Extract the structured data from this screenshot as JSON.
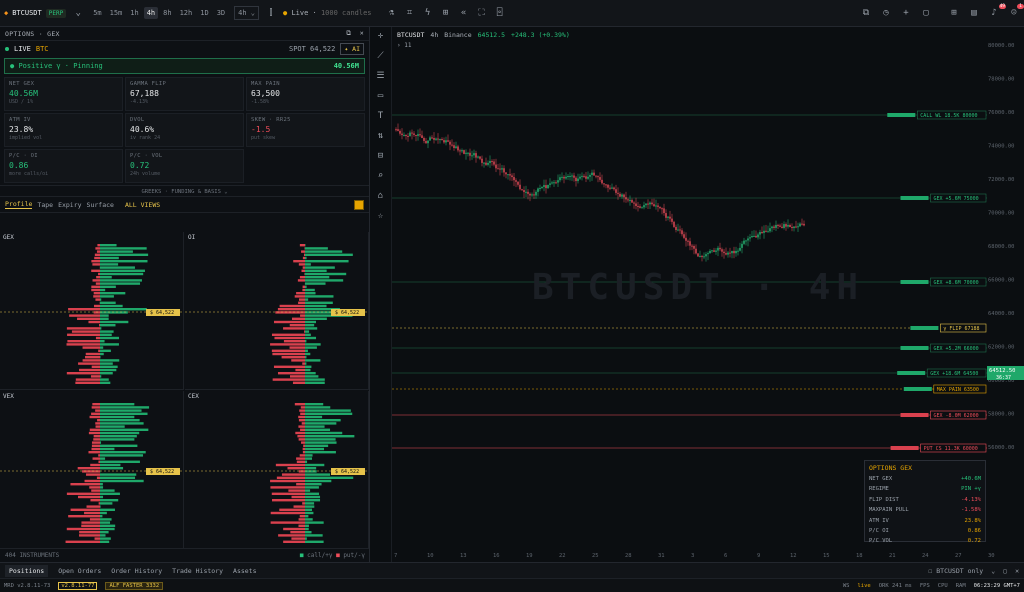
{
  "topbar": {
    "symbol": "BTCUSDT",
    "badge": "PERP",
    "timeframes": [
      "5m",
      "15m",
      "1h",
      "4h",
      "8h",
      "12h",
      "1D",
      "3D"
    ],
    "active_tf": "4h",
    "tf_select": "4h",
    "live_label": "Live",
    "candles_label": "1000 candles",
    "notif_count_1": "49",
    "notif_count_2": "1"
  },
  "left": {
    "header": "OPTIONS · GEX",
    "live": "LIVE",
    "asset": "BTC",
    "spot": "SPOT 64,522",
    "ai": "AI",
    "regime_label": "Positive γ · Pinning",
    "regime_value": "40.56M",
    "cards": [
      {
        "t": "NET GEX",
        "v": "40.56M",
        "s": "USD / 1%",
        "cls": "green"
      },
      {
        "t": "GAMMA FLIP",
        "v": "67,188",
        "s": "-4.13%",
        "cls": ""
      },
      {
        "t": "MAX PAIN",
        "v": "63,500",
        "s": "-1.58%",
        "cls": ""
      },
      {
        "t": "ATM IV",
        "v": "23.8%",
        "s": "implied vol",
        "cls": ""
      },
      {
        "t": "DVOL",
        "v": "40.6%",
        "s": "iv rank 24",
        "cls": ""
      },
      {
        "t": "SKEW · RR25",
        "v": "-1.5",
        "s": "put skew",
        "cls": "red"
      },
      {
        "t": "P/C · OI",
        "v": "0.86",
        "s": "more calls/oi",
        "cls": "green"
      },
      {
        "t": "P/C · VOL",
        "v": "0.72",
        "s": "24h volume",
        "cls": "green"
      }
    ],
    "greeks": "GREEKS · FUNDING & BASIS ⌄",
    "tabs": [
      "Profile",
      "Tape",
      "Expiry",
      "Surface"
    ],
    "allviews": "ALL VIEWS",
    "panels": [
      {
        "name": "GEX",
        "spot": "$ 64,522"
      },
      {
        "name": "OI",
        "spot": "$ 64,522"
      },
      {
        "name": "VEX",
        "spot": "$ 64,522"
      },
      {
        "name": "CEX",
        "spot": "$ 64,522"
      }
    ],
    "foot_left": "404 INSTRUMENTS",
    "foot_right_1": "call/+γ",
    "foot_right_2": "put/-γ"
  },
  "chart": {
    "symbol": "BTCUSDT",
    "tf": "4h",
    "exch": "Binance",
    "price": "64512.5",
    "change": "+248.3 (+0.39%)",
    "sub": "› 11",
    "watermark": "BTCUSDT · 4H",
    "yticks": [
      "80000.00",
      "78000.00",
      "76000.00",
      "74000.00",
      "72000.00",
      "70000.00",
      "68000.00",
      "66000.00",
      "64000.00",
      "62000.00",
      "60000.00",
      "58000.00",
      "56000.00"
    ],
    "xticks": [
      "7",
      "10",
      "13",
      "16",
      "19",
      "22",
      "25",
      "28",
      "31",
      "3",
      "6",
      "9",
      "12",
      "15",
      "18",
      "21",
      "24",
      "27",
      "30"
    ],
    "levels": [
      {
        "label": "CALL WL 18.5K 80000",
        "color": "#1f6f4a"
      },
      {
        "label": "GEX +5.6M 75000",
        "color": "#1f6f4a"
      },
      {
        "label": "GEX +8.6M 70000",
        "color": "#1f6f4a"
      },
      {
        "label": "γ FLIP 67188",
        "color": "#e6c34a"
      },
      {
        "label": "GEX +5.2M 66000",
        "color": "#1f6f4a"
      },
      {
        "label": "GEX +18.6M 64500",
        "color": "#1f6f4a"
      },
      {
        "label": "MAX PAIN 63500",
        "color": "#e6a400"
      },
      {
        "label": "GEX -8.0M 62000",
        "color": "#ef4d5a"
      },
      {
        "label": "PUT CS 11.3K 60000",
        "color": "#ef4d5a"
      }
    ],
    "last_price": "64512.50",
    "countdown": "36:37",
    "ogex": {
      "title": "OPTIONS GEX",
      "rows": [
        [
          "NET GEX",
          "+40.6M"
        ],
        [
          "REGIME",
          "PIN +γ"
        ],
        [
          "FLIP DIST",
          "-4.13%"
        ],
        [
          "MAXPAIN PULL",
          "-1.58%"
        ],
        [
          "ATM IV",
          "23.8%"
        ],
        [
          "P/C OI",
          "0.86"
        ],
        [
          "P/C VOL",
          "0.72"
        ]
      ]
    }
  },
  "bottom": {
    "tabs": [
      "Positions",
      "Open Orders",
      "Order History",
      "Trade History",
      "Assets"
    ],
    "filter": "BTCUSDT only"
  },
  "status": {
    "mrd": "MRD v2.8.11-73",
    "ver": "v2.8.11-77",
    "alf": "ALF FASTER 3332",
    "ws": "WS",
    "live": "live",
    "ork": "ORK 241 ms",
    "fps": "FPS",
    "cpu": "CPU",
    "ram": "RAM",
    "time": "06:23:29 GMT+7"
  }
}
